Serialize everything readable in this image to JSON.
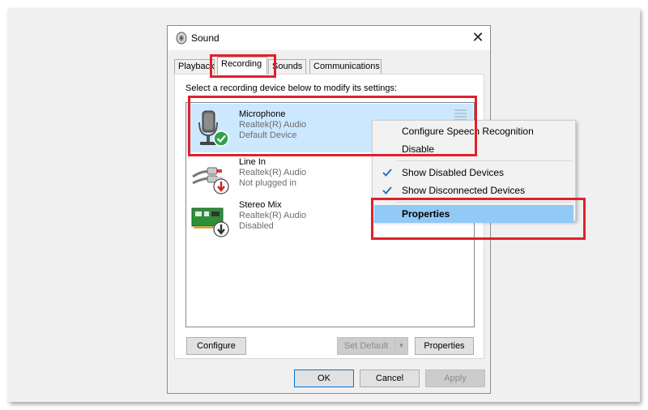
{
  "window": {
    "title": "Sound",
    "close_glyph": "✕",
    "icon": "speaker-icon"
  },
  "tabs": [
    {
      "label": "Playback"
    },
    {
      "label": "Recording"
    },
    {
      "label": "Sounds"
    },
    {
      "label": "Communications"
    }
  ],
  "active_tab": "Recording",
  "panel": {
    "caption": "Select a recording device below to modify its settings:"
  },
  "devices": [
    {
      "name": "Microphone",
      "driver": "Realtek(R) Audio",
      "status": "Default Device",
      "icon": "microphone-icon",
      "badge": "green-check-badge",
      "selected": true
    },
    {
      "name": "Line In",
      "driver": "Realtek(R) Audio",
      "status": "Not plugged in",
      "icon": "rca-cable-icon",
      "badge": "red-down-arrow-badge",
      "selected": false
    },
    {
      "name": "Stereo Mix",
      "driver": "Realtek(R) Audio",
      "status": "Disabled",
      "icon": "sound-card-icon",
      "badge": "gray-down-arrow-badge",
      "selected": false
    }
  ],
  "buttons": {
    "configure": "Configure",
    "set_default": "Set Default",
    "set_default_arrow": "▼",
    "properties": "Properties",
    "ok": "OK",
    "cancel": "Cancel",
    "apply": "Apply"
  },
  "context_menu": {
    "items": [
      {
        "label": "Configure Speech Recognition",
        "checked": false
      },
      {
        "label": "Disable",
        "checked": false
      },
      {
        "label": "Show Disabled Devices",
        "checked": true
      },
      {
        "label": "Show Disconnected Devices",
        "checked": true
      },
      {
        "label": "Properties",
        "checked": false,
        "highlighted": true
      }
    ]
  },
  "colors": {
    "highlight_box": "#e0212b",
    "selection": "#cce8ff",
    "menu_highlight": "#91c9f7",
    "check": "#1e6bb8"
  }
}
